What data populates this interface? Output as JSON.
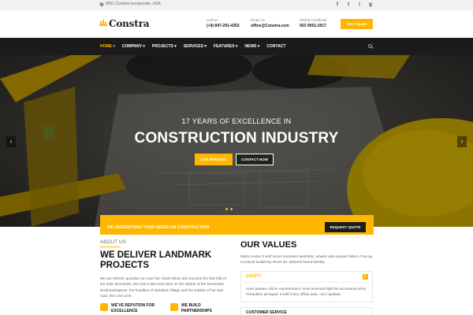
{
  "topbar": {
    "address": "9051 Constra Incorporate, USA",
    "social": [
      "f",
      "t",
      "i",
      "g"
    ]
  },
  "brand": {
    "name": "Constra",
    "color": "#ffb600"
  },
  "header": {
    "call_label": "Call Us",
    "call_value": "(+9) 847-291-4353",
    "email_label": "Email Us",
    "email_value": "office@Constra.com",
    "cert_label": "Global Certificate",
    "cert_value": "ISO 9001:2017",
    "quote_button": "Get A Quote"
  },
  "nav": {
    "items": [
      {
        "label": "Home",
        "active": true
      },
      {
        "label": "Company",
        "active": false
      },
      {
        "label": "Projects",
        "active": false
      },
      {
        "label": "Services",
        "active": false
      },
      {
        "label": "Features",
        "active": false
      },
      {
        "label": "News",
        "active": false
      },
      {
        "label": "Contact",
        "active": false
      }
    ],
    "dropdown_suffix": " ▾"
  },
  "hero": {
    "subtitle": "17 Years of excellence in",
    "title": "Construction Industry",
    "btn_services": "Our Services",
    "btn_contact": "Contact Now",
    "prev_arrow": "‹",
    "next_arrow": "›"
  },
  "cta": {
    "text": "We understand your needs on construction",
    "button": "Request Quote"
  },
  "about": {
    "eyebrow": "About Us",
    "title_line1": "We Deliver Landmark",
    "title_line2": "Projects",
    "body": "We are rethoric question ran over her cheek When she reached the first hills of the Italic Mountains, she had a last view back on the skyline of her hometown Bookmarksgrove, the headline of Alphabet Village and the subline of her own road, the Line Lane.",
    "feature1": "We've Repution for Excellence",
    "feature2": "We Build Partnerships"
  },
  "values": {
    "title": "Our Values",
    "intro": "Minim Austin 3 wolf moon scenester aesthetic, umami odio pariatur bitters. Pop-up occaecat taxidermy street art, tattooed beard literally.",
    "acc1_title": "Safety",
    "acc1_body": "Anim pariatur cliche reprehenderit, enim eiusmod high life accusamus terry richardson ad squid. 3 wolf moon officia aute, non cupidata",
    "acc2_title": "Customer Service",
    "toggle_symbol": "+"
  }
}
